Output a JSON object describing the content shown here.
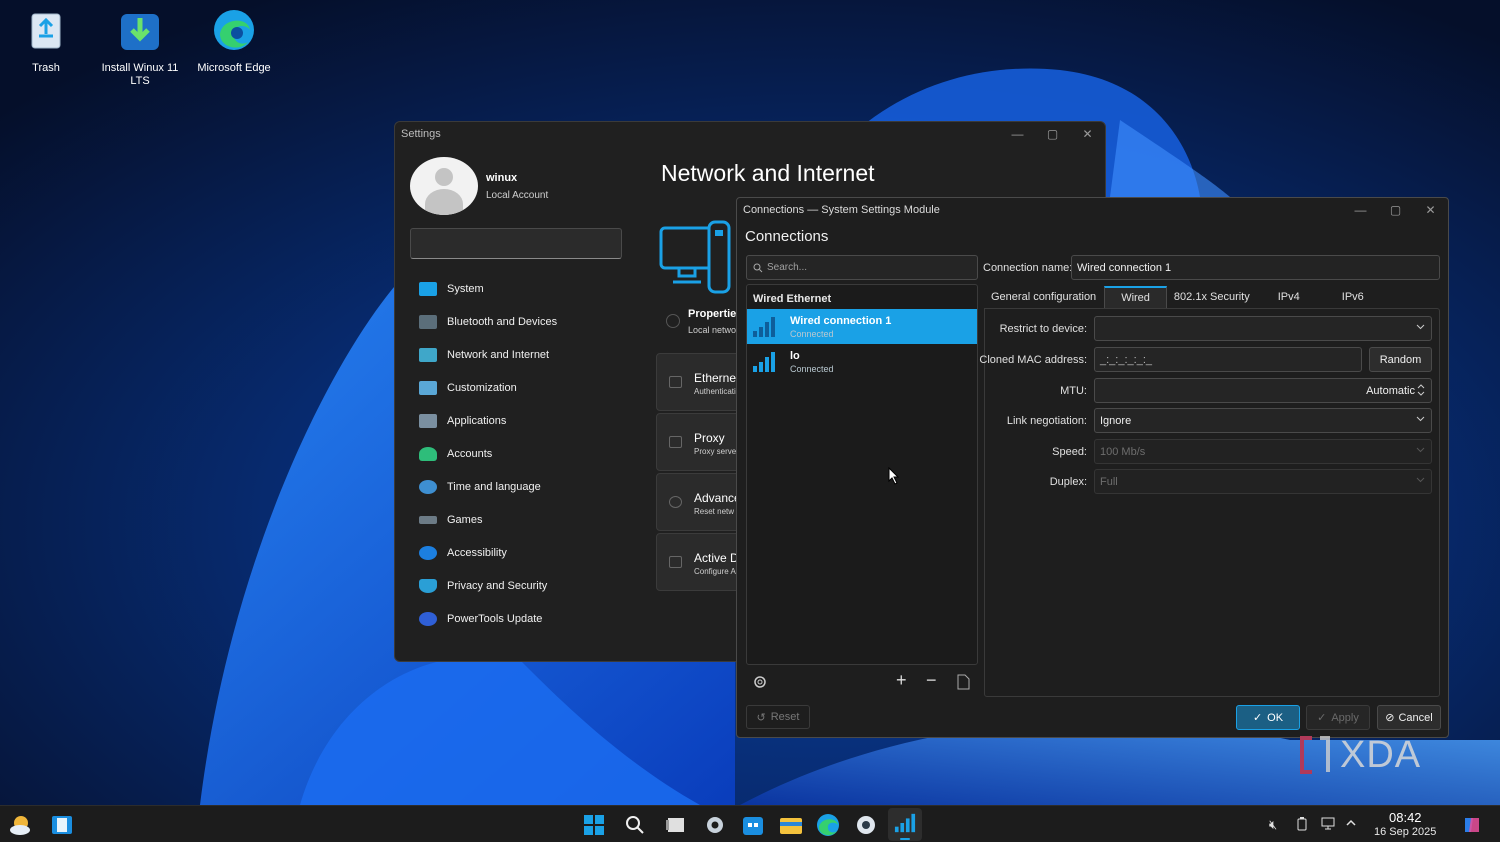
{
  "desktop": {
    "icons": [
      {
        "label": "Trash"
      },
      {
        "label": "Install Winux 11 LTS"
      },
      {
        "label": "Microsoft Edge"
      }
    ]
  },
  "settings": {
    "title": "Settings",
    "user": {
      "name": "winux",
      "account_type": "Local Account"
    },
    "nav": [
      {
        "label": "System",
        "icon": "monitor-icon"
      },
      {
        "label": "Bluetooth and Devices",
        "icon": "bluetooth-devices-icon"
      },
      {
        "label": "Network and Internet",
        "icon": "network-icon"
      },
      {
        "label": "Customization",
        "icon": "paintbrush-icon"
      },
      {
        "label": "Applications",
        "icon": "apps-icon"
      },
      {
        "label": "Accounts",
        "icon": "person-icon"
      },
      {
        "label": "Time and language",
        "icon": "globe-clock-icon"
      },
      {
        "label": "Games",
        "icon": "gamepad-icon"
      },
      {
        "label": "Accessibility",
        "icon": "accessibility-icon"
      },
      {
        "label": "Privacy and Security",
        "icon": "shield-icon"
      },
      {
        "label": "PowerTools Update",
        "icon": "refresh-icon"
      }
    ],
    "heading": "Network and Internet",
    "properties": {
      "title": "Properties",
      "subtitle": "Local netwo"
    },
    "cards": [
      {
        "title": "Ethernet",
        "subtitle": "Authenticati"
      },
      {
        "title": "Proxy",
        "subtitle": "Proxy serve"
      },
      {
        "title": "Advance",
        "subtitle": "Reset netw"
      },
      {
        "title": "Active D",
        "subtitle": "Configure A"
      }
    ]
  },
  "connections": {
    "title": "Connections — System Settings Module",
    "heading": "Connections",
    "search_placeholder": "Search...",
    "group_label": "Wired Ethernet",
    "items": [
      {
        "name": "Wired connection 1",
        "status": "Connected",
        "selected": true
      },
      {
        "name": "lo",
        "status": "Connected",
        "selected": false
      }
    ],
    "connection_name_label": "Connection name:",
    "connection_name_value": "Wired connection 1",
    "tabs": [
      "General configuration",
      "Wired",
      "802.1x Security",
      "IPv4",
      "IPv6"
    ],
    "active_tab": "Wired",
    "fields": {
      "restrict_label": "Restrict to device:",
      "restrict_value": "",
      "mac_label": "Cloned MAC address:",
      "mac_value": "_:_:_:_:_:_",
      "random_label": "Random",
      "mtu_label": "MTU:",
      "mtu_value": "Automatic",
      "link_label": "Link negotiation:",
      "link_value": "Ignore",
      "speed_label": "Speed:",
      "speed_value": "100 Mb/s",
      "duplex_label": "Duplex:",
      "duplex_value": "Full"
    },
    "buttons": {
      "reset": "Reset",
      "ok": "OK",
      "apply": "Apply",
      "cancel": "Cancel"
    }
  },
  "watermark": "XDA",
  "taskbar": {
    "time": "08:42",
    "date": "16 Sep 2025",
    "accent": "#1aa1e6"
  }
}
